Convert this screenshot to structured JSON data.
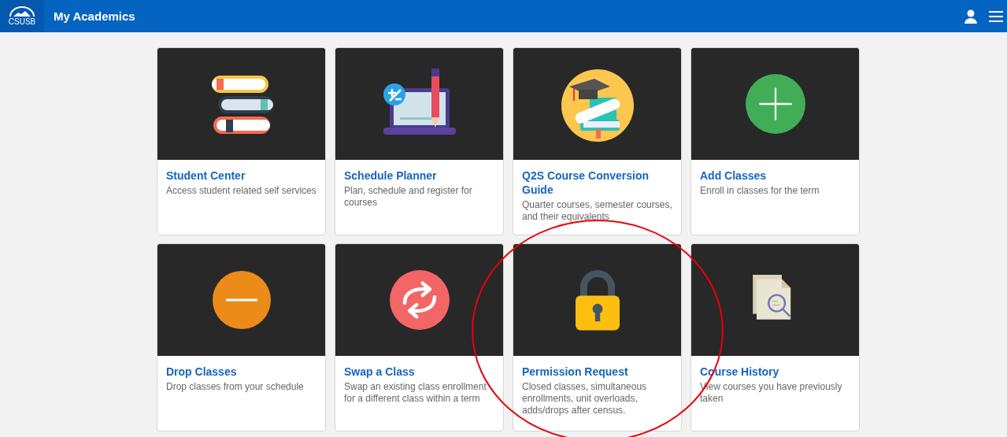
{
  "header": {
    "logo_text": "CSUSB",
    "title": "My Academics"
  },
  "tiles": [
    {
      "kind": "books",
      "title": "Student Center",
      "description": "Access student related self services"
    },
    {
      "kind": "laptop",
      "title": "Schedule Planner",
      "description": "Plan, schedule and register for courses"
    },
    {
      "kind": "graduation",
      "title": "Q2S Course Conversion Guide",
      "description": "Quarter courses, semester courses, and their equivalents"
    },
    {
      "kind": "plus",
      "title": "Add Classes",
      "description": "Enroll in classes for the term"
    },
    {
      "kind": "minus",
      "title": "Drop Classes",
      "description": "Drop classes from your schedule"
    },
    {
      "kind": "swap",
      "title": "Swap a Class",
      "description": "Swap an existing class enrollment for a different class within a term"
    },
    {
      "kind": "lock",
      "title": "Permission Request",
      "description": "Closed classes, simultaneous enrollments, unit overloads, adds/drops after census.",
      "circled": true
    },
    {
      "kind": "document",
      "title": "Course History",
      "description": "View courses you have previously taken"
    }
  ]
}
